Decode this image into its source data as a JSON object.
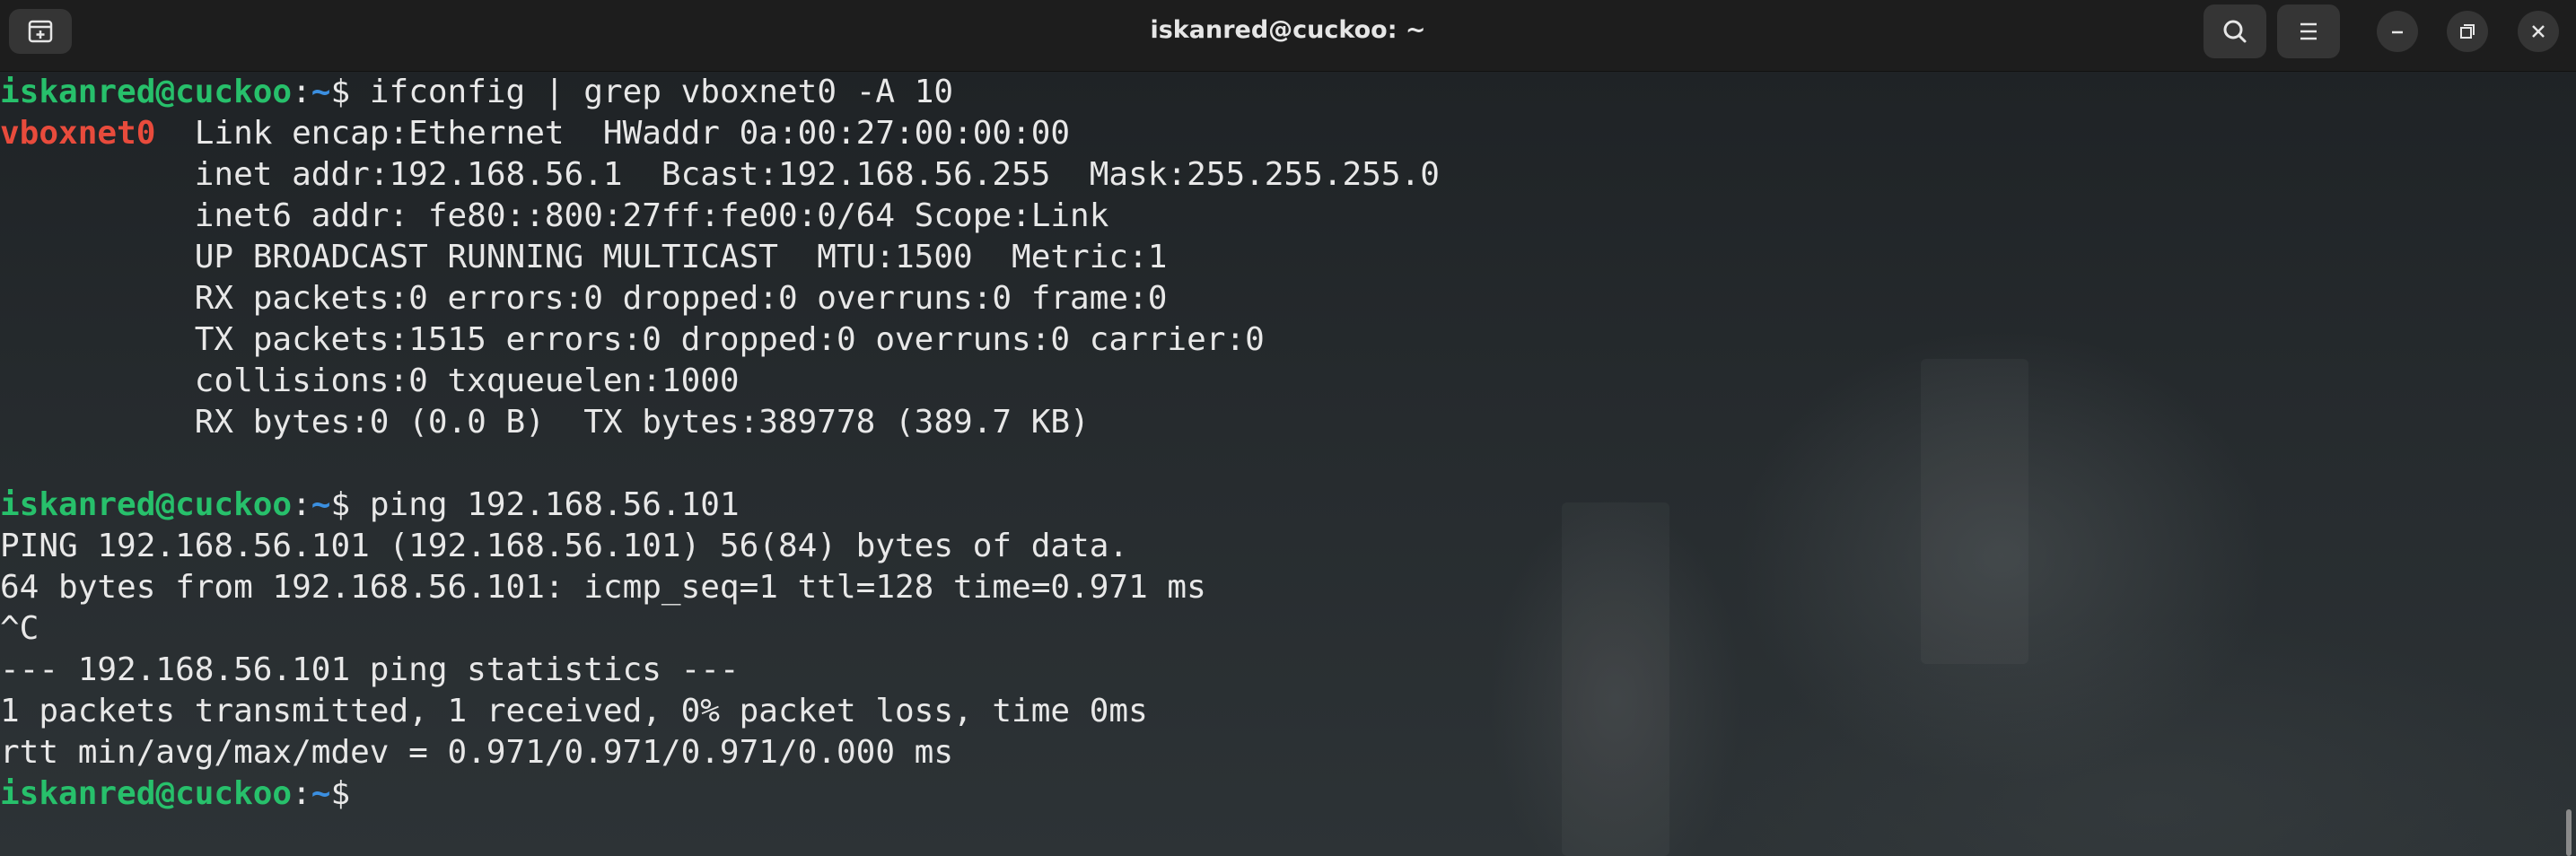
{
  "window": {
    "title": "iskanred@cuckoo: ~"
  },
  "icons": {
    "new_tab": "new-tab-icon",
    "search": "search-icon",
    "menu": "hamburger-menu-icon",
    "minimize": "minimize-icon",
    "maximize": "restore-icon",
    "close": "close-icon"
  },
  "colors": {
    "prompt_user": "#27c06b",
    "prompt_path": "#3b8fe0",
    "interface_name": "#e84b3c",
    "text": "#e8e8e8",
    "titlebar": "#1d1d1d"
  },
  "prompt": {
    "user_host": "iskanred@cuckoo",
    "colon": ":",
    "path": "~",
    "dollar": "$ "
  },
  "commands": {
    "ifconfig": "ifconfig | grep vboxnet0 -A 10",
    "ping": "ping 192.168.56.101"
  },
  "ifconfig_output": {
    "iface_name": "vboxnet0",
    "first_line_rest": "  Link encap:Ethernet  HWaddr 0a:00:27:00:00:00",
    "lines": [
      "          inet addr:192.168.56.1  Bcast:192.168.56.255  Mask:255.255.255.0",
      "          inet6 addr: fe80::800:27ff:fe00:0/64 Scope:Link",
      "          UP BROADCAST RUNNING MULTICAST  MTU:1500  Metric:1",
      "          RX packets:0 errors:0 dropped:0 overruns:0 frame:0",
      "          TX packets:1515 errors:0 dropped:0 overruns:0 carrier:0",
      "          collisions:0 txqueuelen:1000",
      "          RX bytes:0 (0.0 B)  TX bytes:389778 (389.7 KB)"
    ]
  },
  "ping_output": {
    "lines": [
      "PING 192.168.56.101 (192.168.56.101) 56(84) bytes of data.",
      "64 bytes from 192.168.56.101: icmp_seq=1 ttl=128 time=0.971 ms",
      "^C",
      "--- 192.168.56.101 ping statistics ---",
      "1 packets transmitted, 1 received, 0% packet loss, time 0ms",
      "rtt min/avg/max/mdev = 0.971/0.971/0.971/0.000 ms"
    ]
  }
}
